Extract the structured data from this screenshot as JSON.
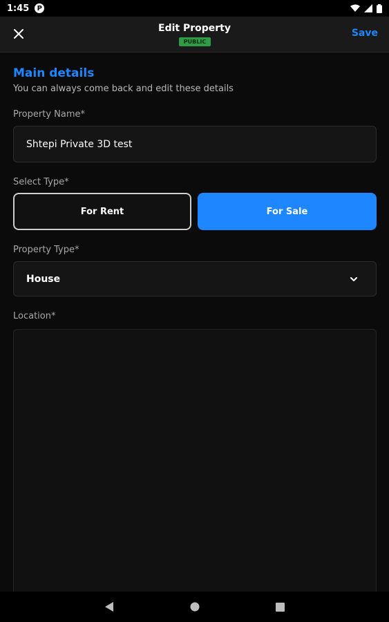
{
  "status_bar": {
    "time": "1:45",
    "notification_letter": "P"
  },
  "header": {
    "title": "Edit Property",
    "badge": "PUBLIC",
    "save_label": "Save"
  },
  "section": {
    "title": "Main details",
    "subtitle": "You can always come back and edit these details"
  },
  "form": {
    "property_name": {
      "label": "Property Name*",
      "value": "Shtepi Private 3D test"
    },
    "select_type": {
      "label": "Select Type*",
      "options": [
        "For Rent",
        "For Sale"
      ],
      "selected": "For Sale"
    },
    "property_type": {
      "label": "Property Type*",
      "value": "House"
    },
    "location": {
      "label": "Location*"
    }
  },
  "colors": {
    "accent": "#1e86ff",
    "badge_green": "#2f9d45",
    "background": "#0b0b0b"
  },
  "icons": [
    "close-icon",
    "chevron-down-icon",
    "wifi-icon",
    "signal-icon",
    "battery-icon",
    "back-icon",
    "home-icon",
    "recents-icon"
  ]
}
